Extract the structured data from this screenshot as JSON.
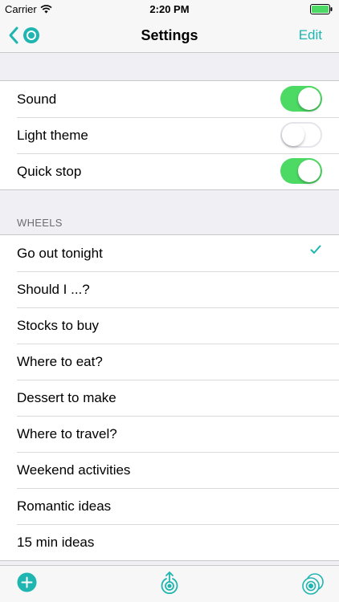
{
  "status_bar": {
    "carrier": "Carrier",
    "time": "2:20 PM"
  },
  "nav": {
    "title": "Settings",
    "edit_label": "Edit"
  },
  "settings": [
    {
      "label": "Sound",
      "on": true
    },
    {
      "label": "Light theme",
      "on": false
    },
    {
      "label": "Quick stop",
      "on": true
    }
  ],
  "wheels_section": {
    "header": "WHEELS"
  },
  "wheels": [
    {
      "label": "Go out tonight",
      "selected": true
    },
    {
      "label": "Should I ...?",
      "selected": false
    },
    {
      "label": "Stocks to buy",
      "selected": false
    },
    {
      "label": "Where to eat?",
      "selected": false
    },
    {
      "label": "Dessert to make",
      "selected": false
    },
    {
      "label": "Where to travel?",
      "selected": false
    },
    {
      "label": "Weekend activities",
      "selected": false
    },
    {
      "label": "Romantic ideas",
      "selected": false
    },
    {
      "label": "15 min ideas",
      "selected": false
    }
  ],
  "colors": {
    "accent": "#1fb5b0",
    "switch_on": "#4cd964",
    "battery": "#4cd964"
  },
  "icons": {
    "back": "chevron-left-icon",
    "wheel": "wheel-icon",
    "wifi": "wifi-icon",
    "add": "plus-circle-icon",
    "share": "share-icon",
    "wheels": "wheels-stack-icon",
    "check": "checkmark-icon"
  }
}
